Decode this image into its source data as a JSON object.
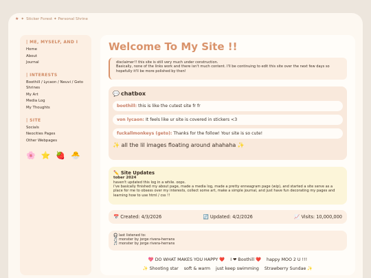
{
  "window": {
    "title": "Sticker Forest ✦ Personal Shrine",
    "title_prefix": "✦"
  },
  "sidebar": {
    "sections": [
      {
        "title": "ME, MYSELF, AND I",
        "items": [
          "Home",
          "About",
          "Journal"
        ]
      },
      {
        "title": "INTERESTS",
        "items": [
          "Boothill / Lycaon / Neuvi / Geto Shrines",
          "My Art",
          "Media Log",
          "My Thoughts"
        ]
      },
      {
        "title": "SITE",
        "items": [
          "Socials",
          "Neocities Pages",
          "Other Webpages"
        ]
      }
    ],
    "stickers": [
      "🌸",
      "⭐",
      "🍓",
      "🐣"
    ]
  },
  "main": {
    "welcome": "Welcome To My Site !!",
    "disclaimer_line1": "disclaimer!! this site is still very much under construction.",
    "disclaimer_line2": "Basically, none of the links work and there isn't much content. I'll be continuing to edit this site over the next few days so hopefully it'll be more polished by then!",
    "chatbox": {
      "title": "chatbox",
      "messages": [
        {
          "user": "boothill:",
          "text": "this is like the cutest site fr fr"
        },
        {
          "user": "von lycaon:",
          "text": "It feels like ur site is covered in stickers <3"
        },
        {
          "user": "fuckallmonkeys (geto):",
          "text": "Thanks for the follow! Your site is so cute!"
        }
      ],
      "footer": "✨ all the lil images floating around ahahaha ✨"
    },
    "updates": {
      "title": "Site Updates",
      "date": "tober 2024",
      "line1": "haven't updated this log in a while. oops.",
      "line2": "i've basically finished my about page, made a media log, made a pretty enneagram page (wip), and started a site serve as a place for me to obsess over my interests, collect some art, make a simple journal, and just have fun decorating my pages and learning how to use html / css !!"
    },
    "stats": {
      "created": "Created: 4/3/2026",
      "updated": "Updated: 4/2/2026",
      "visits": "Visits: 10,000,000"
    },
    "listened": {
      "label": "last listened to:",
      "tracks": [
        "monster by jorge rivera-herrans",
        "monster by jorge rivera-herrans"
      ]
    },
    "buttons_row1": [
      "💖 DO WHAT MAKES YOU HAPPY ❤️",
      "I ❤ Boothill ❤️",
      "happy MOO 2 U !!!"
    ],
    "buttons_row2": [
      "✨ Shooting star",
      "soft & warm",
      "just keep swimming",
      "Strawberry Sundae ✨"
    ]
  }
}
